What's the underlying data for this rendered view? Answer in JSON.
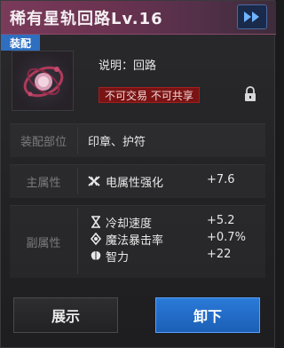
{
  "header": {
    "title": "稀有星轨回路Lv.16",
    "fast_forward_icon": "fast-forward-icon"
  },
  "item": {
    "equip_tag": "装配",
    "description": "说明：回路",
    "restriction": "不可交易 不可共享",
    "lock_icon": "lock-icon"
  },
  "slot": {
    "label": "装配部位",
    "value": "印章、护符"
  },
  "main_attr": {
    "label": "主属性",
    "icon": "electric-attr-icon",
    "name": "电属性强化",
    "value": "+7.6"
  },
  "sub_attr": {
    "label": "副属性",
    "items": [
      {
        "icon": "hourglass-icon",
        "name": "冷却速度",
        "value": "+5.2"
      },
      {
        "icon": "magic-crit-icon",
        "name": "魔法暴击率",
        "value": "+0.7%"
      },
      {
        "icon": "brain-icon",
        "name": "智力",
        "value": "+22"
      }
    ]
  },
  "buttons": {
    "show": "展示",
    "unequip": "卸下"
  },
  "colors": {
    "header": "#7a3a5a",
    "equip_tag": "#2f6fc0",
    "restriction": "#7a1414",
    "primary_button": "#2a7ad8"
  }
}
